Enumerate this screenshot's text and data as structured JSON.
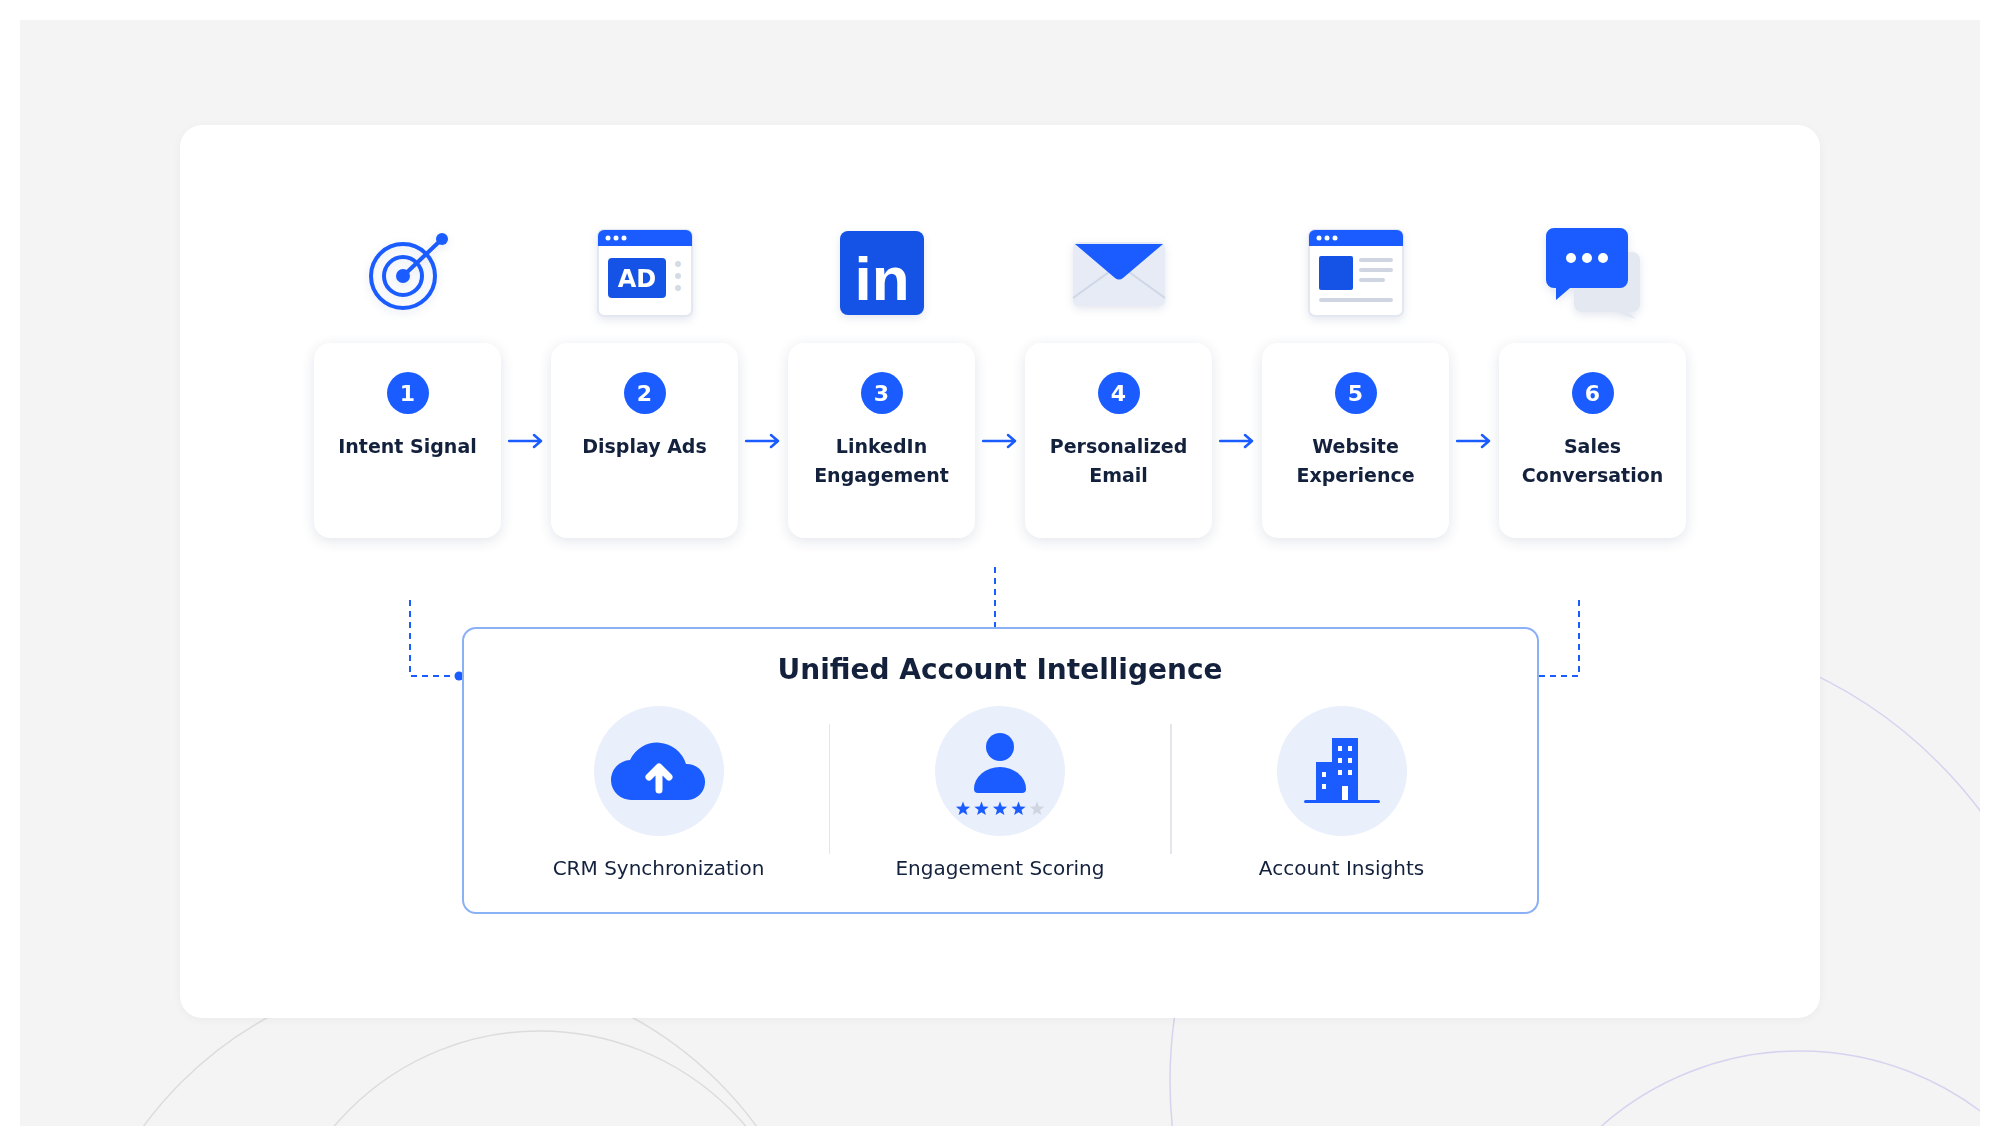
{
  "steps": [
    {
      "number": "1",
      "label": "Intent Signal",
      "kind": "target"
    },
    {
      "number": "2",
      "label": "Display Ads",
      "kind": "ad-window",
      "icon_text": "AD"
    },
    {
      "number": "3",
      "label": "LinkedIn Engagement",
      "kind": "linkedin",
      "icon_text": "in"
    },
    {
      "number": "4",
      "label": "Personalized Email",
      "kind": "envelope"
    },
    {
      "number": "5",
      "label": "Website Experience",
      "kind": "web-page"
    },
    {
      "number": "6",
      "label": "Sales Conversation",
      "kind": "chat"
    }
  ],
  "hub": {
    "title": "Unified Account Intelligence",
    "features": [
      {
        "label": "CRM Synchronization",
        "kind": "cloud-upload"
      },
      {
        "label": "Engagement Scoring",
        "kind": "person-rating",
        "stars": 4
      },
      {
        "label": "Account Insights",
        "kind": "building"
      }
    ]
  }
}
